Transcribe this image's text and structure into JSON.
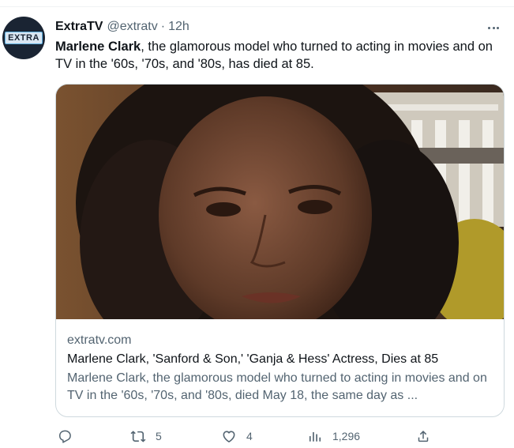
{
  "tweet": {
    "avatar_logo": "EXTRA",
    "author_name": "ExtraTV",
    "author_handle": "@extratv",
    "separator": "·",
    "timestamp": "12h",
    "text_bold": "Marlene Clark",
    "text_rest": ", the glamorous model who turned to acting in movies and on TV in the '60s, '70s, and '80s, has died at 85."
  },
  "card": {
    "domain": "extratv.com",
    "title": "Marlene Clark, 'Sanford & Son,' 'Ganja & Hess' Actress, Dies at 85",
    "description": "Marlene Clark, the glamorous model who turned to acting in movies and on TV in the '60s, '70s, and '80s, died May 18, the same day as ..."
  },
  "actions": {
    "reply_icon": "reply-icon",
    "retweet_icon": "retweet-icon",
    "retweet_count": "5",
    "like_icon": "heart-icon",
    "like_count": "4",
    "views_icon": "analytics-icon",
    "views_count": "1,296",
    "share_icon": "share-icon"
  },
  "colors": {
    "text_primary": "#0f1419",
    "text_secondary": "#536471",
    "border": "#cfd9de"
  }
}
